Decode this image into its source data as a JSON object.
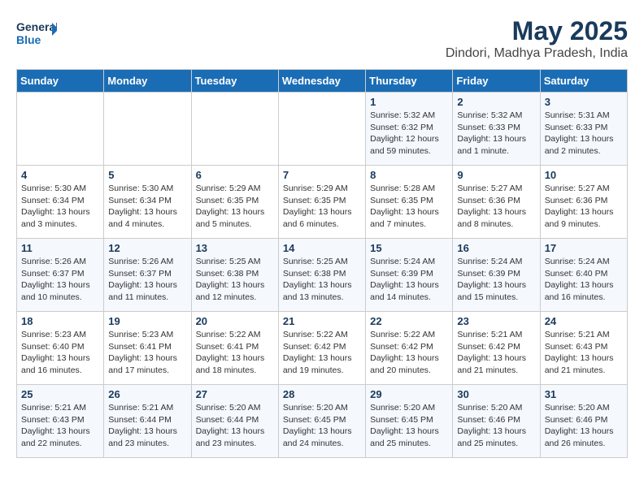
{
  "header": {
    "logo_line1": "General",
    "logo_line2": "Blue",
    "month": "May 2025",
    "location": "Dindori, Madhya Pradesh, India"
  },
  "weekdays": [
    "Sunday",
    "Monday",
    "Tuesday",
    "Wednesday",
    "Thursday",
    "Friday",
    "Saturday"
  ],
  "weeks": [
    [
      {
        "day": "",
        "info": ""
      },
      {
        "day": "",
        "info": ""
      },
      {
        "day": "",
        "info": ""
      },
      {
        "day": "",
        "info": ""
      },
      {
        "day": "1",
        "info": "Sunrise: 5:32 AM\nSunset: 6:32 PM\nDaylight: 12 hours\nand 59 minutes."
      },
      {
        "day": "2",
        "info": "Sunrise: 5:32 AM\nSunset: 6:33 PM\nDaylight: 13 hours\nand 1 minute."
      },
      {
        "day": "3",
        "info": "Sunrise: 5:31 AM\nSunset: 6:33 PM\nDaylight: 13 hours\nand 2 minutes."
      }
    ],
    [
      {
        "day": "4",
        "info": "Sunrise: 5:30 AM\nSunset: 6:34 PM\nDaylight: 13 hours\nand 3 minutes."
      },
      {
        "day": "5",
        "info": "Sunrise: 5:30 AM\nSunset: 6:34 PM\nDaylight: 13 hours\nand 4 minutes."
      },
      {
        "day": "6",
        "info": "Sunrise: 5:29 AM\nSunset: 6:35 PM\nDaylight: 13 hours\nand 5 minutes."
      },
      {
        "day": "7",
        "info": "Sunrise: 5:29 AM\nSunset: 6:35 PM\nDaylight: 13 hours\nand 6 minutes."
      },
      {
        "day": "8",
        "info": "Sunrise: 5:28 AM\nSunset: 6:35 PM\nDaylight: 13 hours\nand 7 minutes."
      },
      {
        "day": "9",
        "info": "Sunrise: 5:27 AM\nSunset: 6:36 PM\nDaylight: 13 hours\nand 8 minutes."
      },
      {
        "day": "10",
        "info": "Sunrise: 5:27 AM\nSunset: 6:36 PM\nDaylight: 13 hours\nand 9 minutes."
      }
    ],
    [
      {
        "day": "11",
        "info": "Sunrise: 5:26 AM\nSunset: 6:37 PM\nDaylight: 13 hours\nand 10 minutes."
      },
      {
        "day": "12",
        "info": "Sunrise: 5:26 AM\nSunset: 6:37 PM\nDaylight: 13 hours\nand 11 minutes."
      },
      {
        "day": "13",
        "info": "Sunrise: 5:25 AM\nSunset: 6:38 PM\nDaylight: 13 hours\nand 12 minutes."
      },
      {
        "day": "14",
        "info": "Sunrise: 5:25 AM\nSunset: 6:38 PM\nDaylight: 13 hours\nand 13 minutes."
      },
      {
        "day": "15",
        "info": "Sunrise: 5:24 AM\nSunset: 6:39 PM\nDaylight: 13 hours\nand 14 minutes."
      },
      {
        "day": "16",
        "info": "Sunrise: 5:24 AM\nSunset: 6:39 PM\nDaylight: 13 hours\nand 15 minutes."
      },
      {
        "day": "17",
        "info": "Sunrise: 5:24 AM\nSunset: 6:40 PM\nDaylight: 13 hours\nand 16 minutes."
      }
    ],
    [
      {
        "day": "18",
        "info": "Sunrise: 5:23 AM\nSunset: 6:40 PM\nDaylight: 13 hours\nand 16 minutes."
      },
      {
        "day": "19",
        "info": "Sunrise: 5:23 AM\nSunset: 6:41 PM\nDaylight: 13 hours\nand 17 minutes."
      },
      {
        "day": "20",
        "info": "Sunrise: 5:22 AM\nSunset: 6:41 PM\nDaylight: 13 hours\nand 18 minutes."
      },
      {
        "day": "21",
        "info": "Sunrise: 5:22 AM\nSunset: 6:42 PM\nDaylight: 13 hours\nand 19 minutes."
      },
      {
        "day": "22",
        "info": "Sunrise: 5:22 AM\nSunset: 6:42 PM\nDaylight: 13 hours\nand 20 minutes."
      },
      {
        "day": "23",
        "info": "Sunrise: 5:21 AM\nSunset: 6:42 PM\nDaylight: 13 hours\nand 21 minutes."
      },
      {
        "day": "24",
        "info": "Sunrise: 5:21 AM\nSunset: 6:43 PM\nDaylight: 13 hours\nand 21 minutes."
      }
    ],
    [
      {
        "day": "25",
        "info": "Sunrise: 5:21 AM\nSunset: 6:43 PM\nDaylight: 13 hours\nand 22 minutes."
      },
      {
        "day": "26",
        "info": "Sunrise: 5:21 AM\nSunset: 6:44 PM\nDaylight: 13 hours\nand 23 minutes."
      },
      {
        "day": "27",
        "info": "Sunrise: 5:20 AM\nSunset: 6:44 PM\nDaylight: 13 hours\nand 23 minutes."
      },
      {
        "day": "28",
        "info": "Sunrise: 5:20 AM\nSunset: 6:45 PM\nDaylight: 13 hours\nand 24 minutes."
      },
      {
        "day": "29",
        "info": "Sunrise: 5:20 AM\nSunset: 6:45 PM\nDaylight: 13 hours\nand 25 minutes."
      },
      {
        "day": "30",
        "info": "Sunrise: 5:20 AM\nSunset: 6:46 PM\nDaylight: 13 hours\nand 25 minutes."
      },
      {
        "day": "31",
        "info": "Sunrise: 5:20 AM\nSunset: 6:46 PM\nDaylight: 13 hours\nand 26 minutes."
      }
    ]
  ]
}
